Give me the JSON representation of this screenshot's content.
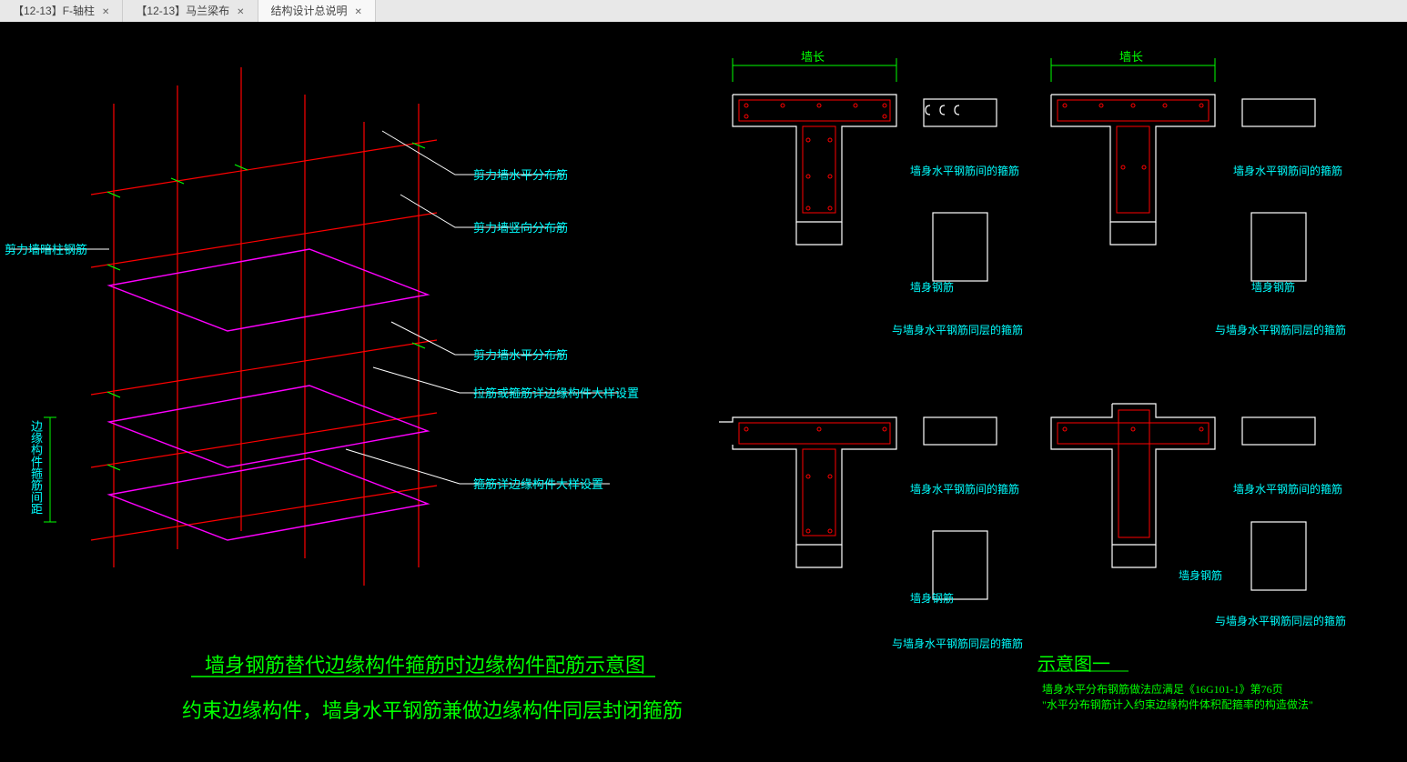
{
  "tabs": {
    "t1": "【12-13】F-轴柱",
    "t2": "【12-13】马兰梁布",
    "t3": "结构设计总说明"
  },
  "iso": {
    "lbl_vert": "边缘构件箍筋间距",
    "lbl_left": "剪力墙暗柱钢筋",
    "ann1": "剪力墙水平分布筋",
    "ann2": "剪力墙竖向分布筋",
    "ann3": "剪力墙水平分布筋",
    "ann4": "拉筋或箍筋详边缘构件大样设置",
    "ann5": "箍筋详边缘构件大样设置",
    "title1": "墙身钢筋替代边缘构件箍筋时边缘构件配筋示意图",
    "title2": "约束边缘构件，墙身水平钢筋兼做边缘构件同层封闭箍筋"
  },
  "sections": {
    "wall_len": "墙长",
    "a1": "墙身水平钢筋间的箍筋",
    "a2": "墙身钢筋",
    "a3": "与墙身水平钢筋同层的箍筋",
    "title_right": "示意图一",
    "note1": "墙身水平分布钢筋做法应满足《16G101-1》第76页",
    "note2": "\"水平分布钢筋计入约束边缘构件体积配箍率的构造做法\""
  }
}
